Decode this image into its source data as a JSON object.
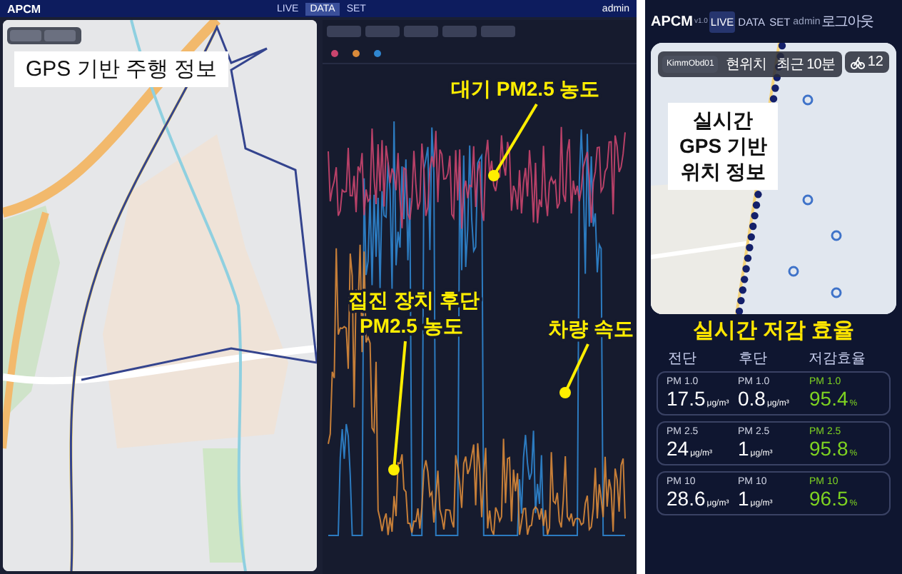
{
  "dashboard": {
    "header": {
      "logo": "APCM",
      "nav": [
        {
          "label": "LIVE",
          "selected": false
        },
        {
          "label": "DATA",
          "selected": true
        },
        {
          "label": "SET",
          "selected": false
        }
      ],
      "user": "admin"
    },
    "map_panel": {
      "caption": "GPS 기반 주행 정보"
    },
    "chart_panel": {
      "series": [
        {
          "color": "#c9456e"
        },
        {
          "color": "#d98a3a"
        },
        {
          "color": "#2f86d0"
        }
      ],
      "annotations": [
        {
          "text": "대기 PM2.5 농도"
        },
        {
          "text": "집진 장치 후단\nPM2.5 농도"
        },
        {
          "text": "차량 속도"
        }
      ]
    }
  },
  "mobile": {
    "header": {
      "logo": "APCM",
      "version": "v1.0",
      "nav": [
        {
          "label": "LIVE",
          "selected": true
        },
        {
          "label": "DATA",
          "selected": false
        },
        {
          "label": "SET",
          "selected": false
        }
      ],
      "user": "admin",
      "logout": "로그아웃"
    },
    "map": {
      "device": "KimmObd01",
      "location_button": "현위치",
      "time_filter": "최근 10분",
      "count": "12",
      "caption": "실시간\nGPS 기반\n위치 정보"
    },
    "efficiency": {
      "title": "실시간 저감 효율",
      "columns": [
        "전단",
        "후단",
        "저감효율"
      ],
      "rows": [
        {
          "front": {
            "label": "PM 1.0",
            "value": "17.5",
            "unit": "μg/m³"
          },
          "rear": {
            "label": "PM 1.0",
            "value": "0.8",
            "unit": "μg/m³"
          },
          "efficiency": {
            "label": "PM 1.0",
            "value": "95.4",
            "unit": "%"
          }
        },
        {
          "front": {
            "label": "PM 2.5",
            "value": "24",
            "unit": "μg/m³"
          },
          "rear": {
            "label": "PM 2.5",
            "value": "1",
            "unit": "μg/m³"
          },
          "efficiency": {
            "label": "PM 2.5",
            "value": "95.8",
            "unit": "%"
          }
        },
        {
          "front": {
            "label": "PM 10",
            "value": "28.6",
            "unit": "μg/m³"
          },
          "rear": {
            "label": "PM 10",
            "value": "1",
            "unit": "μg/m³"
          },
          "efficiency": {
            "label": "PM 10",
            "value": "96.5",
            "unit": "%"
          }
        }
      ]
    }
  }
}
